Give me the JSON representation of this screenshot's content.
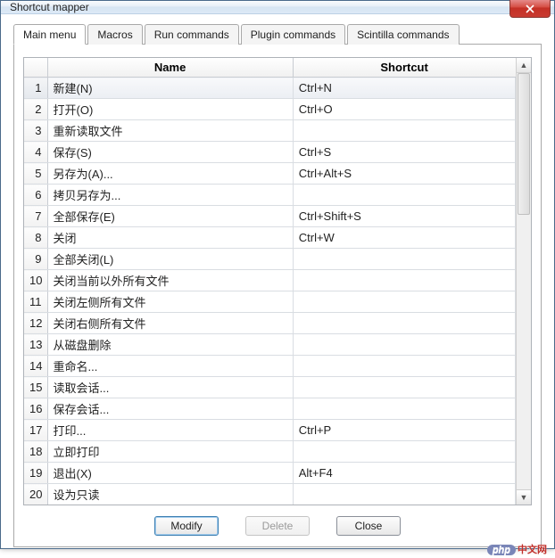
{
  "window": {
    "title": "Shortcut mapper"
  },
  "tabs": [
    {
      "label": "Main menu",
      "active": true
    },
    {
      "label": "Macros",
      "active": false
    },
    {
      "label": "Run commands",
      "active": false
    },
    {
      "label": "Plugin commands",
      "active": false
    },
    {
      "label": "Scintilla commands",
      "active": false
    }
  ],
  "columns": {
    "name": "Name",
    "shortcut": "Shortcut"
  },
  "rows": [
    {
      "n": 1,
      "name": "新建(N)",
      "shortcut": "Ctrl+N",
      "selected": true
    },
    {
      "n": 2,
      "name": "打开(O)",
      "shortcut": "Ctrl+O",
      "selected": false
    },
    {
      "n": 3,
      "name": "重新读取文件",
      "shortcut": "",
      "selected": false
    },
    {
      "n": 4,
      "name": "保存(S)",
      "shortcut": "Ctrl+S",
      "selected": false
    },
    {
      "n": 5,
      "name": "另存为(A)...",
      "shortcut": "Ctrl+Alt+S",
      "selected": false
    },
    {
      "n": 6,
      "name": "拷贝另存为...",
      "shortcut": "",
      "selected": false
    },
    {
      "n": 7,
      "name": "全部保存(E)",
      "shortcut": "Ctrl+Shift+S",
      "selected": false
    },
    {
      "n": 8,
      "name": "关闭",
      "shortcut": "Ctrl+W",
      "selected": false
    },
    {
      "n": 9,
      "name": "全部关闭(L)",
      "shortcut": "",
      "selected": false
    },
    {
      "n": 10,
      "name": "关闭当前以外所有文件",
      "shortcut": "",
      "selected": false
    },
    {
      "n": 11,
      "name": "关闭左侧所有文件",
      "shortcut": "",
      "selected": false
    },
    {
      "n": 12,
      "name": "关闭右侧所有文件",
      "shortcut": "",
      "selected": false
    },
    {
      "n": 13,
      "name": "从磁盘删除",
      "shortcut": "",
      "selected": false
    },
    {
      "n": 14,
      "name": "重命名...",
      "shortcut": "",
      "selected": false
    },
    {
      "n": 15,
      "name": "读取会话...",
      "shortcut": "",
      "selected": false
    },
    {
      "n": 16,
      "name": "保存会话...",
      "shortcut": "",
      "selected": false
    },
    {
      "n": 17,
      "name": "打印...",
      "shortcut": "Ctrl+P",
      "selected": false
    },
    {
      "n": 18,
      "name": "立即打印",
      "shortcut": "",
      "selected": false
    },
    {
      "n": 19,
      "name": "退出(X)",
      "shortcut": "Alt+F4",
      "selected": false
    },
    {
      "n": 20,
      "name": "设为只读",
      "shortcut": "",
      "selected": false
    }
  ],
  "buttons": {
    "modify": "Modify",
    "delete": "Delete",
    "close": "Close"
  },
  "watermark": {
    "badge": "php",
    "text": "中文网"
  }
}
